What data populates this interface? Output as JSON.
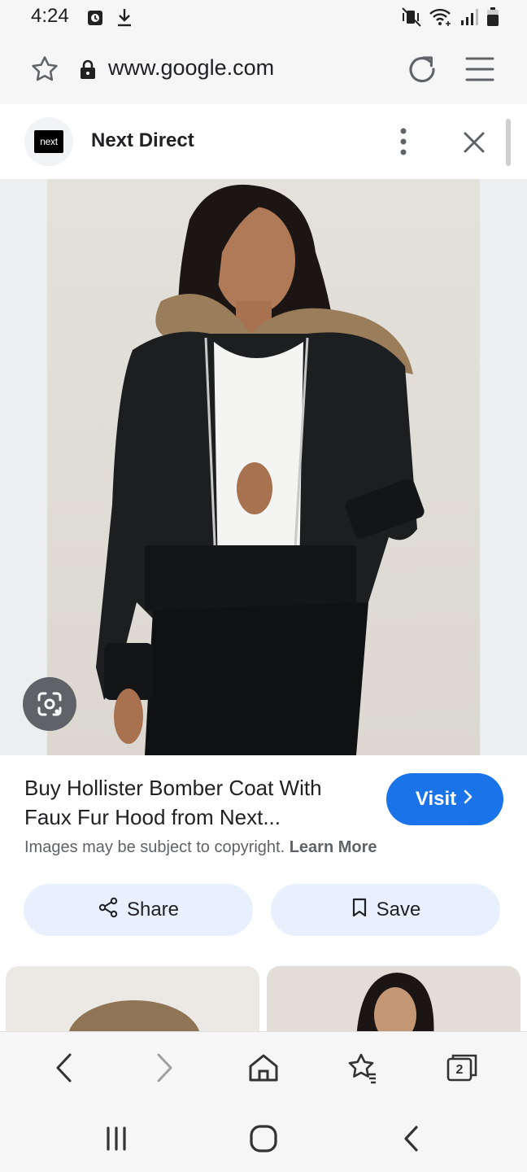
{
  "status_bar": {
    "time": "4:24",
    "icons_left": [
      "clock-alarm-icon",
      "download-icon"
    ],
    "icons_right": [
      "mute-vibrate-icon",
      "wifi-icon",
      "signal-icon",
      "battery-icon"
    ]
  },
  "browser": {
    "url": "www.google.com",
    "bottom_toolbar": {
      "tab_count": "2"
    }
  },
  "source": {
    "logo_text": "next",
    "name": "Next Direct"
  },
  "result": {
    "title": "Buy Hollister Bomber Coat With Faux Fur Hood from Next...",
    "visit_label": "Visit",
    "copyright_text": "Images may be subject to copyright.",
    "learn_more": "Learn More",
    "share_label": "Share",
    "save_label": "Save"
  },
  "colors": {
    "accent": "#1a73e8",
    "chip_bg": "#e8f0fe",
    "chrome_bg": "#f6f6f6"
  }
}
